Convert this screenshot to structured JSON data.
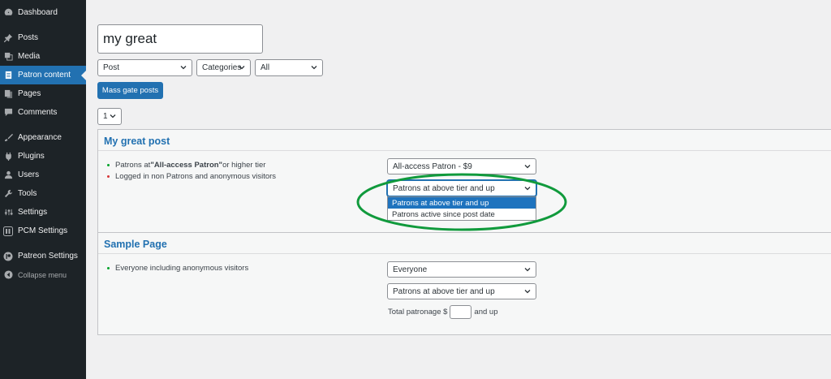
{
  "sidebar": {
    "items": [
      {
        "label": "Dashboard",
        "icon": "dashboard-icon",
        "active": false
      },
      {
        "label": "Posts",
        "icon": "pin-icon",
        "active": false
      },
      {
        "label": "Media",
        "icon": "media-icon",
        "active": false
      },
      {
        "label": "Patron content",
        "icon": "page-icon",
        "active": true
      },
      {
        "label": "Pages",
        "icon": "pages-icon",
        "active": false
      },
      {
        "label": "Comments",
        "icon": "comment-icon",
        "active": false
      },
      {
        "label": "Appearance",
        "icon": "brush-icon",
        "active": false
      },
      {
        "label": "Plugins",
        "icon": "plugin-icon",
        "active": false
      },
      {
        "label": "Users",
        "icon": "user-icon",
        "active": false
      },
      {
        "label": "Tools",
        "icon": "wrench-icon",
        "active": false
      },
      {
        "label": "Settings",
        "icon": "settings-icon",
        "active": false
      },
      {
        "label": "PCM Settings",
        "icon": "pcm-icon",
        "active": false
      },
      {
        "label": "Patreon Settings",
        "icon": "patreon-icon",
        "active": false
      },
      {
        "label": "Collapse menu",
        "icon": "collapse-icon",
        "active": false
      }
    ]
  },
  "search": {
    "value": "my great"
  },
  "filters": {
    "post_type": "Post",
    "taxonomy": "Categories",
    "term": "All"
  },
  "mass_gate_button": "Mass gate posts",
  "page_select": "1",
  "posts": [
    {
      "title": "My great post",
      "rules": [
        {
          "prefix": "Patrons at ",
          "emphasis": "\"All-access Patron\"",
          "suffix": " or higher tier",
          "color": "green"
        },
        {
          "text": "Logged in non Patrons and anonymous visitors",
          "color": "red"
        }
      ],
      "tier_select": "All-access Patron - $9",
      "mode_select": "Patrons at above tier and up",
      "dropdown_options": [
        "Patrons at above tier and up",
        "Patrons active since post date"
      ]
    },
    {
      "title": "Sample Page",
      "rules": [
        {
          "text": "Everyone including anonymous visitors",
          "color": "green"
        }
      ],
      "tier_select": "Everyone",
      "mode_select": "Patrons at above tier and up",
      "total_label": "Total patronage $",
      "total_suffix": "and up"
    }
  ],
  "colors": {
    "sidebar_bg": "#1d2327",
    "accent": "#2271b1",
    "highlight_ellipse": "#109a3c"
  }
}
